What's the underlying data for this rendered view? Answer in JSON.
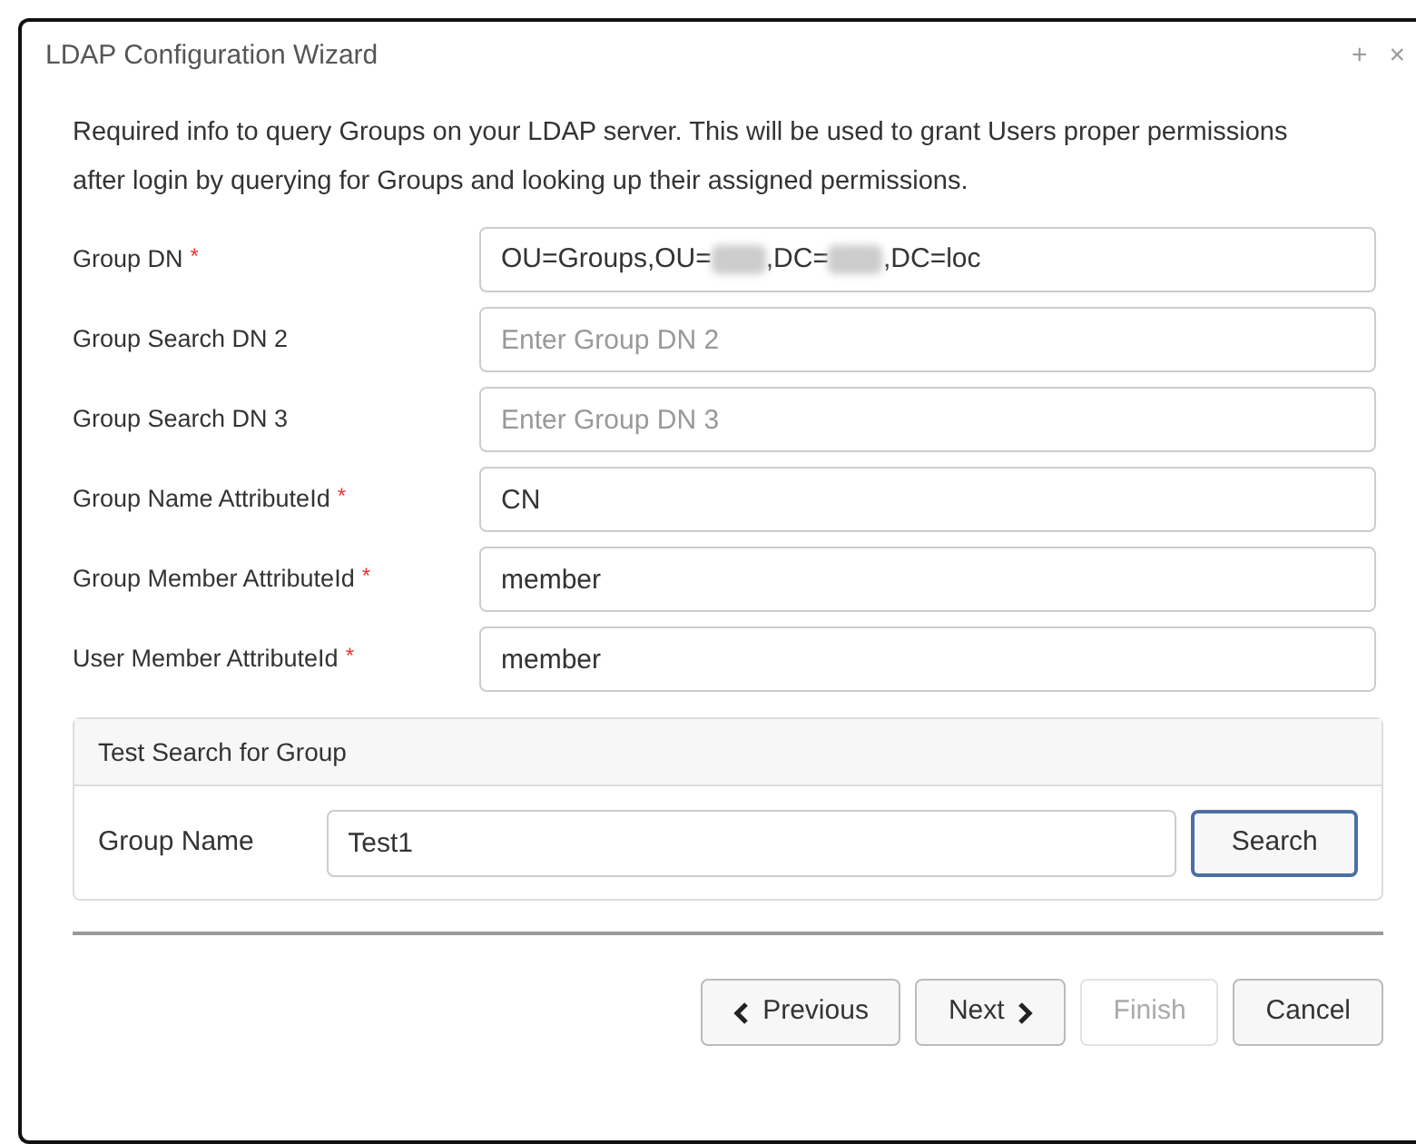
{
  "window": {
    "title": "LDAP Configuration Wizard",
    "controls": [
      "+",
      "×"
    ]
  },
  "intro": "Required info to query Groups on your LDAP server. This will be used to grant Users proper permissions after login by querying for Groups and looking up their assigned permissions.",
  "fields": [
    {
      "label": "Group DN",
      "required_mark": "*",
      "segments": [
        {
          "kind": "text",
          "text": "OU=Groups,OU="
        },
        {
          "kind": "redacted"
        },
        {
          "kind": "text",
          "text": ",DC="
        },
        {
          "kind": "redacted"
        },
        {
          "kind": "text",
          "text": ",DC=loc"
        }
      ]
    },
    {
      "label": "Group Search DN 2",
      "placeholder": "Enter Group DN 2"
    },
    {
      "label": "Group Search DN 3",
      "placeholder": "Enter Group DN 3"
    },
    {
      "label": "Group Name AttributeId",
      "required_mark": "*",
      "value": "CN"
    },
    {
      "label": "Group Member AttributeId",
      "required_mark": "*",
      "value": "member"
    },
    {
      "label": "User Member AttributeId",
      "required_mark": "*",
      "value": "member"
    }
  ],
  "test_panel": {
    "title": "Test Search for Group",
    "label": "Group Name",
    "value": "Test1",
    "button": "Search"
  },
  "buttons": [
    {
      "label": "Previous",
      "kind": "previous",
      "disabled": false
    },
    {
      "label": "Next",
      "kind": "next",
      "disabled": false
    },
    {
      "label": "Finish",
      "kind": "plain",
      "disabled": true
    },
    {
      "label": "Cancel",
      "kind": "plain",
      "disabled": false
    }
  ]
}
